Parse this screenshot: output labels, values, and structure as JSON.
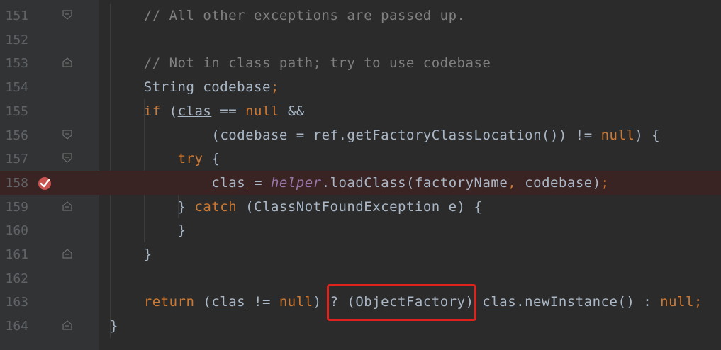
{
  "editor": {
    "lines": [
      {
        "num": "151",
        "fold": "fold-end",
        "indent": 2,
        "tokens": [
          {
            "t": "comment",
            "v": "// All other exceptions are passed up."
          }
        ]
      },
      {
        "num": "152",
        "fold": "",
        "indent": 0,
        "tokens": []
      },
      {
        "num": "153",
        "fold": "fold-start",
        "indent": 2,
        "tokens": [
          {
            "t": "comment",
            "v": "// Not in class path; try to use codebase"
          }
        ]
      },
      {
        "num": "154",
        "fold": "",
        "indent": 2,
        "tokens": [
          {
            "t": "plain",
            "v": "String codebase"
          },
          {
            "t": "kw",
            "v": ";"
          }
        ]
      },
      {
        "num": "155",
        "fold": "",
        "indent": 2,
        "tokens": [
          {
            "t": "kw",
            "v": "if "
          },
          {
            "t": "plain",
            "v": "("
          },
          {
            "t": "field",
            "v": "clas"
          },
          {
            "t": "plain",
            "v": " == "
          },
          {
            "t": "kw",
            "v": "null "
          },
          {
            "t": "plain",
            "v": "&&"
          }
        ]
      },
      {
        "num": "156",
        "fold": "fold-end",
        "indent": 6,
        "tokens": [
          {
            "t": "plain",
            "v": "(codebase = ref.getFactoryClassLocation()) != "
          },
          {
            "t": "kw",
            "v": "null"
          },
          {
            "t": "plain",
            "v": ") {"
          }
        ]
      },
      {
        "num": "157",
        "fold": "fold-end",
        "indent": 4,
        "tokens": [
          {
            "t": "kw",
            "v": "try "
          },
          {
            "t": "plain",
            "v": "{"
          }
        ]
      },
      {
        "num": "158",
        "fold": "",
        "indent": 6,
        "breakpoint": true,
        "tokens": [
          {
            "t": "field",
            "v": "clas"
          },
          {
            "t": "plain",
            "v": " = "
          },
          {
            "t": "italic",
            "v": "helper"
          },
          {
            "t": "plain",
            "v": ".loadClass(factoryName"
          },
          {
            "t": "kw",
            "v": ", "
          },
          {
            "t": "plain",
            "v": "codebase)"
          },
          {
            "t": "kw",
            "v": ";"
          }
        ]
      },
      {
        "num": "159",
        "fold": "fold-start",
        "indent": 4,
        "tokens": [
          {
            "t": "plain",
            "v": "} "
          },
          {
            "t": "kw",
            "v": "catch "
          },
          {
            "t": "plain",
            "v": "(ClassNotFoundException e) {"
          }
        ]
      },
      {
        "num": "160",
        "fold": "",
        "indent": 4,
        "tokens": [
          {
            "t": "plain",
            "v": "}"
          }
        ]
      },
      {
        "num": "161",
        "fold": "fold-start",
        "indent": 2,
        "tokens": [
          {
            "t": "plain",
            "v": "}"
          }
        ]
      },
      {
        "num": "162",
        "fold": "",
        "indent": 0,
        "tokens": []
      },
      {
        "num": "163",
        "fold": "",
        "indent": 2,
        "tokens": [
          {
            "t": "kw",
            "v": "return "
          },
          {
            "t": "plain",
            "v": "("
          },
          {
            "t": "field",
            "v": "clas"
          },
          {
            "t": "plain",
            "v": " != "
          },
          {
            "t": "kw",
            "v": "null"
          },
          {
            "t": "plain",
            "v": ") ? (ObjectFactory) "
          },
          {
            "t": "field",
            "v": "clas"
          },
          {
            "t": "plain",
            "v": ".newInstance() : "
          },
          {
            "t": "kw",
            "v": "null;"
          }
        ]
      },
      {
        "num": "164",
        "fold": "fold-start",
        "indent": 0,
        "tokens": [
          {
            "t": "plain",
            "v": "}"
          }
        ]
      }
    ]
  },
  "colors": {
    "background": "#2b2b2b",
    "gutter": "#313335",
    "breakpoint_line": "#3a2323",
    "keyword": "#cc7832",
    "comment": "#808080",
    "plain": "#a9b7c6",
    "italic_field": "#9876aa",
    "highlight_box": "#e0221c"
  },
  "icons": {
    "fold_start": "fold-start-icon",
    "fold_end": "fold-end-icon",
    "breakpoint": "breakpoint-check-icon"
  }
}
